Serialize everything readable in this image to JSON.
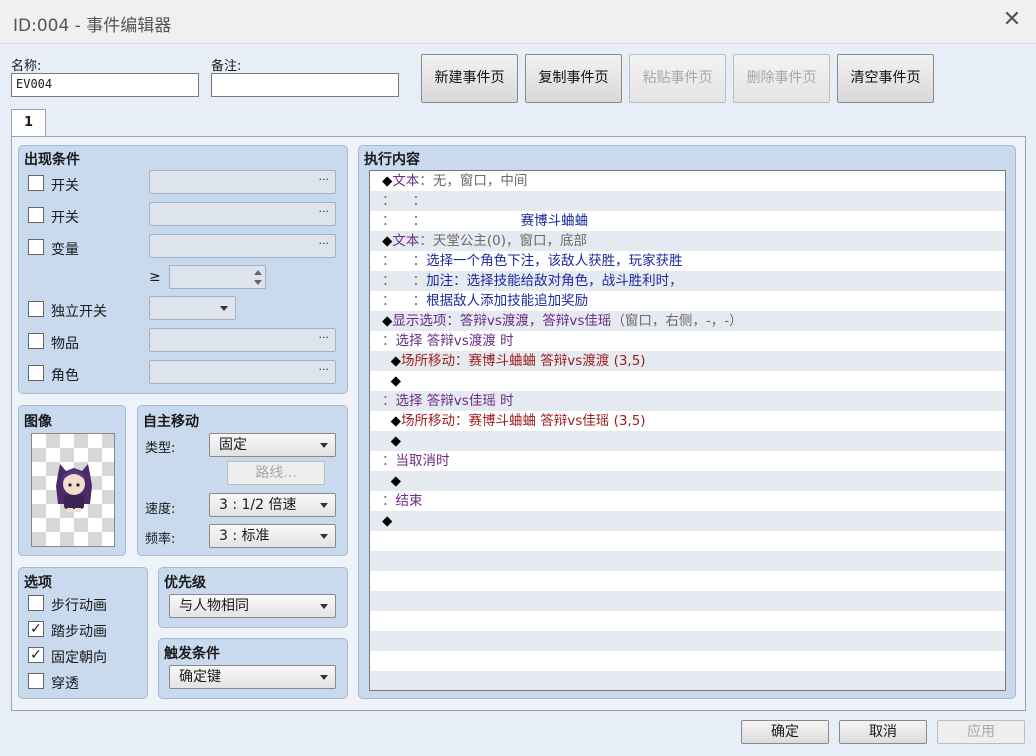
{
  "window": {
    "title": "ID:004 - 事件编辑器"
  },
  "header": {
    "name_label": "名称:",
    "name_value": "EV004",
    "note_label": "备注:",
    "note_value": ""
  },
  "page_buttons": [
    {
      "label": "新建事件页",
      "enabled": true
    },
    {
      "label": "复制事件页",
      "enabled": true
    },
    {
      "label": "粘贴事件页",
      "enabled": false
    },
    {
      "label": "删除事件页",
      "enabled": false
    },
    {
      "label": "清空事件页",
      "enabled": true
    }
  ],
  "tabs": [
    {
      "label": "1"
    }
  ],
  "conditions": {
    "title": "出现条件",
    "items": [
      {
        "label": "开关",
        "checked": false,
        "dots": "···"
      },
      {
        "label": "开关",
        "checked": false,
        "dots": "···"
      },
      {
        "label": "变量",
        "checked": false,
        "dots": "···"
      },
      {
        "label": "独立开关",
        "checked": false
      },
      {
        "label": "物品",
        "checked": false,
        "dots": "···"
      },
      {
        "label": "角色",
        "checked": false,
        "dots": "···"
      }
    ],
    "ge_symbol": "≥"
  },
  "image": {
    "title": "图像"
  },
  "autonomous": {
    "title": "自主移动",
    "type_label": "类型:",
    "type_value": "固定",
    "route_button": "路线...",
    "speed_label": "速度:",
    "speed_value": "3 : 1/2 倍速",
    "freq_label": "频率:",
    "freq_value": "3 : 标准"
  },
  "options": {
    "title": "选项",
    "items": [
      {
        "label": "步行动画",
        "checked": false
      },
      {
        "label": "踏步动画",
        "checked": true
      },
      {
        "label": "固定朝向",
        "checked": true
      },
      {
        "label": "穿透",
        "checked": false
      }
    ],
    "check_glyph": "✓"
  },
  "priority": {
    "title": "优先级",
    "value": "与人物相同"
  },
  "trigger": {
    "title": "触发条件",
    "value": "确定键"
  },
  "contents": {
    "title": "执行内容",
    "rows": [
      [
        {
          "t": "◆",
          "c": "dia"
        },
        {
          "t": "文本",
          "c": "kw"
        },
        {
          "t": "：无，窗口，中间",
          "c": "gray"
        }
      ],
      [
        {
          "t": "：    ：",
          "c": "gray"
        }
      ],
      [
        {
          "t": "：    ：",
          "c": "gray"
        },
        {
          "t": "                      赛博斗蛐蛐",
          "c": "blue"
        }
      ],
      [
        {
          "t": "◆",
          "c": "dia"
        },
        {
          "t": "文本",
          "c": "kw"
        },
        {
          "t": "：天堂公主(0)，窗口，底部",
          "c": "gray"
        }
      ],
      [
        {
          "t": "：    ：",
          "c": "gray"
        },
        {
          "t": "选择一个角色下注，该敌人获胜，玩家获胜",
          "c": "blue"
        }
      ],
      [
        {
          "t": "：    ：",
          "c": "gray"
        },
        {
          "t": "加注：选择技能给敌对角色，战斗胜利时，",
          "c": "blue"
        }
      ],
      [
        {
          "t": "：    ：",
          "c": "gray"
        },
        {
          "t": "根据敌人添加技能追加奖励",
          "c": "blue"
        }
      ],
      [
        {
          "t": "◆",
          "c": "dia"
        },
        {
          "t": "显示选项：答辩vs渡渡，答辩vs佳瑶",
          "c": "kw"
        },
        {
          "t": "（窗口，右侧，-，-）",
          "c": "gray"
        }
      ],
      [
        {
          "t": "：",
          "c": "gray"
        },
        {
          "t": "选择 答辩vs渡渡 时",
          "c": "kw"
        }
      ],
      [
        {
          "t": "  ◆",
          "c": "dia"
        },
        {
          "t": "场所移动：赛博斗蛐蛐 答辩vs渡渡 (3,5)",
          "c": "red"
        }
      ],
      [
        {
          "t": "  ◆",
          "c": "dia"
        }
      ],
      [
        {
          "t": "：",
          "c": "gray"
        },
        {
          "t": "选择 答辩vs佳瑶 时",
          "c": "kw"
        }
      ],
      [
        {
          "t": "  ◆",
          "c": "dia"
        },
        {
          "t": "场所移动：赛博斗蛐蛐 答辩vs佳瑶 (3,5)",
          "c": "red"
        }
      ],
      [
        {
          "t": "  ◆",
          "c": "dia"
        }
      ],
      [
        {
          "t": "：",
          "c": "gray"
        },
        {
          "t": "当取消时",
          "c": "kw"
        }
      ],
      [
        {
          "t": "  ◆",
          "c": "dia"
        }
      ],
      [
        {
          "t": "：",
          "c": "gray"
        },
        {
          "t": "结束",
          "c": "kw"
        }
      ],
      [
        {
          "t": "◆",
          "c": "dia"
        }
      ],
      [],
      [],
      [],
      [],
      [],
      [],
      [],
      []
    ]
  },
  "footer": {
    "ok": "确定",
    "cancel": "取消",
    "apply": "应用"
  }
}
